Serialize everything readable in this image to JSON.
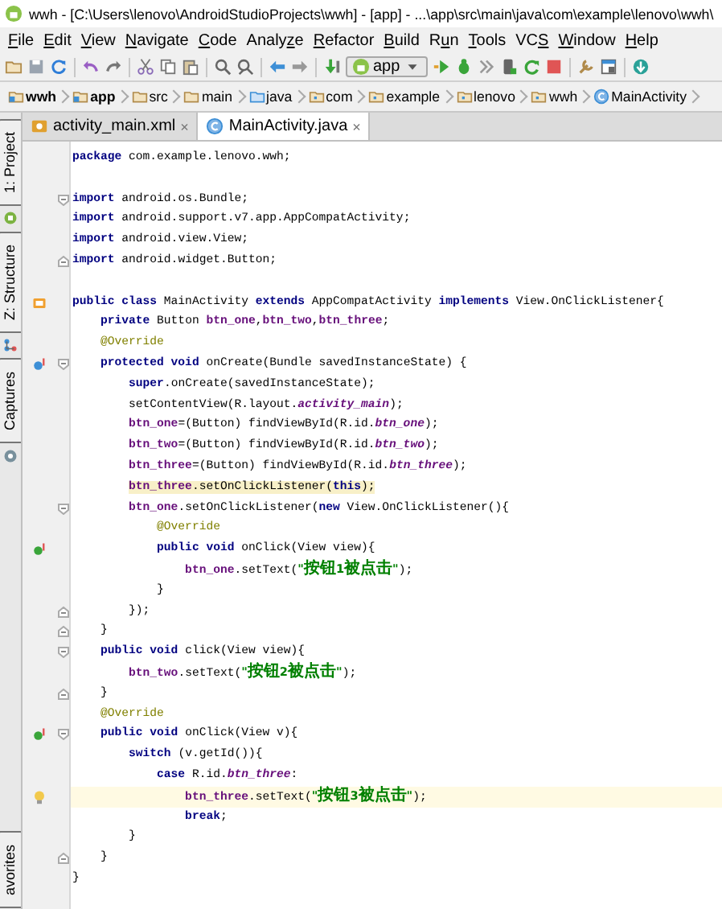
{
  "window": {
    "title": "wwh - [C:\\Users\\lenovo\\AndroidStudioProjects\\wwh] - [app] - ...\\app\\src\\main\\java\\com\\example\\lenovo\\wwh\\"
  },
  "menu": [
    {
      "key": "F",
      "after": "ile"
    },
    {
      "key": "E",
      "after": "dit"
    },
    {
      "key": "V",
      "after": "iew"
    },
    {
      "key": "N",
      "after": "avigate"
    },
    {
      "key": "C",
      "after": "ode"
    },
    {
      "before": "Analy",
      "key": "z",
      "after": "e"
    },
    {
      "key": "R",
      "after": "efactor"
    },
    {
      "key": "B",
      "after": "uild"
    },
    {
      "before": "R",
      "key": "u",
      "after": "n"
    },
    {
      "key": "T",
      "after": "ools"
    },
    {
      "before": "VC",
      "key": "S"
    },
    {
      "key": "W",
      "after": "indow"
    },
    {
      "key": "H",
      "after": "elp"
    }
  ],
  "toolbar": {
    "run_config": "app"
  },
  "breadcrumbs": [
    {
      "label": "wwh",
      "kind": "module"
    },
    {
      "label": "app",
      "kind": "module"
    },
    {
      "label": "src",
      "kind": "folder"
    },
    {
      "label": "main",
      "kind": "folder"
    },
    {
      "label": "java",
      "kind": "source"
    },
    {
      "label": "com",
      "kind": "package"
    },
    {
      "label": "example",
      "kind": "package"
    },
    {
      "label": "lenovo",
      "kind": "package"
    },
    {
      "label": "wwh",
      "kind": "package"
    },
    {
      "label": "MainActivity",
      "kind": "class"
    }
  ],
  "side_tools": [
    {
      "label": "1: Project",
      "kind": "project"
    },
    {
      "label": "Z: Structure",
      "kind": "structure"
    },
    {
      "label": "Captures",
      "kind": "captures"
    },
    {
      "label": "avorites",
      "kind": "plain"
    }
  ],
  "tabs": [
    {
      "label": "activity_main.xml",
      "kind": "xml",
      "close": "×",
      "selected": false
    },
    {
      "label": "MainActivity.java",
      "kind": "class",
      "close": "×",
      "selected": true
    }
  ],
  "code": [
    {
      "tokens": [
        {
          "kind": "kw",
          "text": "package"
        },
        {
          "kind": "plain",
          "text": " com.example.lenovo.wwh;"
        }
      ],
      "caret": false,
      "usage": false
    },
    {
      "caret": false
    },
    {
      "tokens": [
        {
          "kind": "kw",
          "text": "import"
        },
        {
          "kind": "plain",
          "text": " android.os.Bundle;"
        }
      ],
      "fold": {
        "kind": "open"
      },
      "caret": false,
      "usage": false
    },
    {
      "tokens": [
        {
          "kind": "kw",
          "text": "import"
        },
        {
          "kind": "plain",
          "text": " android.support.v7.app.AppCompatActivity;"
        }
      ],
      "caret": false,
      "usage": false
    },
    {
      "tokens": [
        {
          "kind": "kw",
          "text": "import"
        },
        {
          "kind": "plain",
          "text": " android.view.View;"
        }
      ],
      "caret": false,
      "usage": false
    },
    {
      "tokens": [
        {
          "kind": "kw",
          "text": "import"
        },
        {
          "kind": "plain",
          "text": " android.widget.Button;"
        }
      ],
      "fold": {
        "kind": "close"
      },
      "caret": false,
      "usage": false
    },
    {
      "caret": false
    },
    {
      "tokens": [
        {
          "kind": "kw",
          "text": "public class"
        },
        {
          "kind": "plain",
          "text": " MainActivity "
        },
        {
          "kind": "kw",
          "text": "extends"
        },
        {
          "kind": "plain",
          "text": " AppCompatActivity "
        },
        {
          "kind": "kw",
          "text": "implements"
        },
        {
          "kind": "plain",
          "text": " View.OnClickListener{"
        }
      ],
      "gutter": {
        "kind": "class"
      },
      "caret": false,
      "usage": false
    },
    {
      "tokens": [
        {
          "kind": "kw",
          "text": "    private"
        },
        {
          "kind": "plain",
          "text": " Button "
        },
        {
          "kind": "field",
          "text": "btn_one"
        },
        {
          "kind": "plain",
          "text": ","
        },
        {
          "kind": "field",
          "text": "btn_two"
        },
        {
          "kind": "plain",
          "text": ","
        },
        {
          "kind": "field",
          "text": "btn_three"
        },
        {
          "kind": "plain",
          "text": ";"
        }
      ],
      "caret": false,
      "usage": false
    },
    {
      "tokens": [
        {
          "kind": "ann",
          "text": "    @Override"
        }
      ],
      "caret": false,
      "usage": false
    },
    {
      "tokens": [
        {
          "kind": "kw",
          "text": "    protected void"
        },
        {
          "kind": "plain",
          "text": " onCreate(Bundle savedInstanceState) {"
        }
      ],
      "gutter": {
        "kind": "override"
      },
      "fold": {
        "kind": "open"
      },
      "caret": false,
      "usage": false
    },
    {
      "tokens": [
        {
          "kind": "kw",
          "text": "        super"
        },
        {
          "kind": "plain",
          "text": ".onCreate(savedInstanceState);"
        }
      ],
      "caret": false,
      "usage": false
    },
    {
      "tokens": [
        {
          "kind": "plain",
          "text": "        setContentView(R.layout."
        },
        {
          "kind": "sfield",
          "text": "activity_main"
        },
        {
          "kind": "plain",
          "text": ");"
        }
      ],
      "caret": false,
      "usage": false
    },
    {
      "tokens": [
        {
          "kind": "field",
          "text": "        btn_one"
        },
        {
          "kind": "plain",
          "text": "=(Button) findViewById(R.id."
        },
        {
          "kind": "sfield",
          "text": "btn_one"
        },
        {
          "kind": "plain",
          "text": ");"
        }
      ],
      "caret": false,
      "usage": false
    },
    {
      "tokens": [
        {
          "kind": "field",
          "text": "        btn_two"
        },
        {
          "kind": "plain",
          "text": "=(Button) findViewById(R.id."
        },
        {
          "kind": "sfield",
          "text": "btn_two"
        },
        {
          "kind": "plain",
          "text": ");"
        }
      ],
      "caret": false,
      "usage": false
    },
    {
      "tokens": [
        {
          "kind": "field",
          "text": "        btn_three"
        },
        {
          "kind": "plain",
          "text": "=(Button) findViewById(R.id."
        },
        {
          "kind": "sfield",
          "text": "btn_three"
        },
        {
          "kind": "plain",
          "text": ");"
        }
      ],
      "caret": false,
      "usage": false
    },
    {
      "tokens": [
        {
          "kind": "field",
          "text": "        btn_three"
        },
        {
          "kind": "plain",
          "text": ".setOnClickListener("
        },
        {
          "kind": "kw",
          "text": "this"
        },
        {
          "kind": "plain",
          "text": ");"
        }
      ],
      "caret": false,
      "usage": true
    },
    {
      "tokens": [
        {
          "kind": "field",
          "text": "        btn_one"
        },
        {
          "kind": "plain",
          "text": ".setOnClickListener("
        },
        {
          "kind": "kw",
          "text": "new"
        },
        {
          "kind": "plain",
          "text": " View.OnClickListener(){"
        }
      ],
      "fold": {
        "kind": "open"
      },
      "caret": false,
      "usage": false
    },
    {
      "tokens": [
        {
          "kind": "ann",
          "text": "            @Override"
        }
      ],
      "caret": false,
      "usage": false
    },
    {
      "tokens": [
        {
          "kind": "kw",
          "text": "            public void"
        },
        {
          "kind": "plain",
          "text": " onClick(View view){"
        }
      ],
      "gutter": {
        "kind": "implement"
      },
      "caret": false,
      "usage": false
    },
    {
      "tokens": [
        {
          "kind": "field",
          "text": "                btn_one"
        },
        {
          "kind": "plain",
          "text": ".setText("
        },
        {
          "kind": "str",
          "text": "\"按钮1被点击\""
        },
        {
          "kind": "plain",
          "text": ");"
        }
      ],
      "caret": false,
      "usage": false
    },
    {
      "tokens": [
        {
          "kind": "plain",
          "text": "            }"
        }
      ],
      "caret": false,
      "usage": false
    },
    {
      "tokens": [
        {
          "kind": "plain",
          "text": "        });"
        }
      ],
      "fold": {
        "kind": "close"
      },
      "caret": false,
      "usage": false
    },
    {
      "tokens": [
        {
          "kind": "plain",
          "text": "    }"
        }
      ],
      "fold": {
        "kind": "close"
      },
      "caret": false,
      "usage": false
    },
    {
      "tokens": [
        {
          "kind": "kw",
          "text": "    public void"
        },
        {
          "kind": "plain",
          "text": " click(View view){"
        }
      ],
      "fold": {
        "kind": "open"
      },
      "caret": false,
      "usage": false
    },
    {
      "tokens": [
        {
          "kind": "field",
          "text": "        btn_two"
        },
        {
          "kind": "plain",
          "text": ".setText("
        },
        {
          "kind": "str",
          "text": "\"按钮2被点击\""
        },
        {
          "kind": "plain",
          "text": ");"
        }
      ],
      "caret": false,
      "usage": false
    },
    {
      "tokens": [
        {
          "kind": "plain",
          "text": "    }"
        }
      ],
      "fold": {
        "kind": "close"
      },
      "caret": false,
      "usage": false
    },
    {
      "tokens": [
        {
          "kind": "ann",
          "text": "    @Override"
        }
      ],
      "caret": false,
      "usage": false
    },
    {
      "tokens": [
        {
          "kind": "kw",
          "text": "    public void"
        },
        {
          "kind": "plain",
          "text": " onClick(View v){"
        }
      ],
      "gutter": {
        "kind": "implement"
      },
      "fold": {
        "kind": "open"
      },
      "caret": false,
      "usage": false
    },
    {
      "tokens": [
        {
          "kind": "kw",
          "text": "        switch"
        },
        {
          "kind": "plain",
          "text": " (v.getId()){"
        }
      ],
      "caret": false,
      "usage": false
    },
    {
      "tokens": [
        {
          "kind": "kw",
          "text": "            case"
        },
        {
          "kind": "plain",
          "text": " R.id."
        },
        {
          "kind": "sfield",
          "text": "btn_three"
        },
        {
          "kind": "plain",
          "text": ":"
        }
      ],
      "caret": false,
      "usage": false
    },
    {
      "tokens": [
        {
          "kind": "field",
          "text": "                btn_three"
        },
        {
          "kind": "plain",
          "text": ".setText("
        },
        {
          "kind": "str",
          "text": "\"按钮3被点击\""
        },
        {
          "kind": "plain",
          "text": ");"
        }
      ],
      "gutter": {
        "kind": "bulb"
      },
      "caret": true,
      "usage": false
    },
    {
      "tokens": [
        {
          "kind": "kw",
          "text": "                break"
        },
        {
          "kind": "plain",
          "text": ";"
        }
      ],
      "caret": false,
      "usage": false
    },
    {
      "tokens": [
        {
          "kind": "plain",
          "text": "        }"
        }
      ],
      "caret": false,
      "usage": false
    },
    {
      "tokens": [
        {
          "kind": "plain",
          "text": "    }"
        }
      ],
      "fold": {
        "kind": "close"
      },
      "caret": false,
      "usage": false
    },
    {
      "tokens": [
        {
          "kind": "plain",
          "text": "}"
        }
      ],
      "caret": false,
      "usage": false
    }
  ]
}
